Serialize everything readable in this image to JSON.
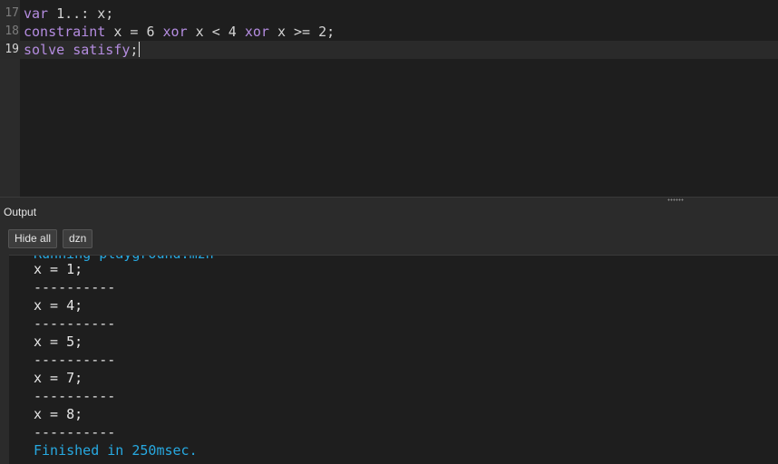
{
  "editor": {
    "lines": [
      {
        "num": "17",
        "parts": [
          {
            "t": "var",
            "kw": true
          },
          {
            "t": " 1..: x;",
            "kw": false
          }
        ]
      },
      {
        "num": "18",
        "parts": [
          {
            "t": "constraint",
            "kw": true
          },
          {
            "t": " x = 6 ",
            "kw": false
          },
          {
            "t": "xor",
            "kw": true
          },
          {
            "t": " x < 4 ",
            "kw": false
          },
          {
            "t": "xor",
            "kw": true
          },
          {
            "t": " x >= 2;",
            "kw": false
          }
        ]
      },
      {
        "num": "19",
        "parts": [
          {
            "t": "solve",
            "kw": true
          },
          {
            "t": " ",
            "kw": false
          },
          {
            "t": "satisfy",
            "kw": true
          },
          {
            "t": ";",
            "kw": false
          }
        ]
      }
    ],
    "current_line": "19"
  },
  "output": {
    "title": "Output",
    "buttons": {
      "hide_all": "Hide all",
      "dzn": "dzn"
    },
    "partial_top_line": "Running playground.mzn",
    "lines": [
      {
        "text": "x = 1;",
        "type": "result"
      },
      {
        "text": "----------",
        "type": "separator"
      },
      {
        "text": "x = 4;",
        "type": "result"
      },
      {
        "text": "----------",
        "type": "separator"
      },
      {
        "text": "x = 5;",
        "type": "result"
      },
      {
        "text": "----------",
        "type": "separator"
      },
      {
        "text": "x = 7;",
        "type": "result"
      },
      {
        "text": "----------",
        "type": "separator"
      },
      {
        "text": "x = 8;",
        "type": "result"
      },
      {
        "text": "----------",
        "type": "separator"
      },
      {
        "text": "Finished in 250msec.",
        "type": "info"
      }
    ]
  },
  "colors": {
    "editor_bg": "#1e1e1e",
    "panel_bg": "#2b2b2b",
    "keyword": "#b48ce0",
    "text": "#d4d4d4",
    "info": "#27a9e1"
  }
}
